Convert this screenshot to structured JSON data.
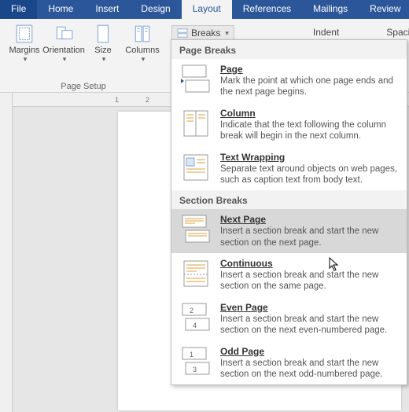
{
  "tabs": {
    "file": "File",
    "home": "Home",
    "insert": "Insert",
    "design": "Design",
    "layout": "Layout",
    "references": "References",
    "mailings": "Mailings",
    "review": "Review"
  },
  "ribbon": {
    "margins": "Margins",
    "orientation": "Orientation",
    "size": "Size",
    "columns": "Columns",
    "group_label": "Page Setup",
    "breaks": "Breaks",
    "indent": "Indent",
    "spacing": "Spacing"
  },
  "ruler": {
    "n1": "1",
    "n2": "2"
  },
  "dropdown": {
    "section_page": "Page Breaks",
    "section_section": "Section Breaks",
    "items": {
      "page": {
        "title": "Page",
        "desc": "Mark the point at which one page ends and the next page begins."
      },
      "column": {
        "title": "Column",
        "desc": "Indicate that the text following the column break will begin in the next column."
      },
      "textwrap": {
        "title": "Text Wrapping",
        "desc": "Separate text around objects on web pages, such as caption text from body text."
      },
      "nextpage": {
        "title": "Next Page",
        "desc": "Insert a section break and start the new section on the next page."
      },
      "continuous": {
        "title": "Continuous",
        "desc": "Insert a section break and start the new section on the same page."
      },
      "evenpage": {
        "title": "Even Page",
        "desc": "Insert a section break and start the new section on the next even-numbered page."
      },
      "oddpage": {
        "title": "Odd Page",
        "desc": "Insert a section break and start the new section on the next odd-numbered page."
      }
    }
  }
}
